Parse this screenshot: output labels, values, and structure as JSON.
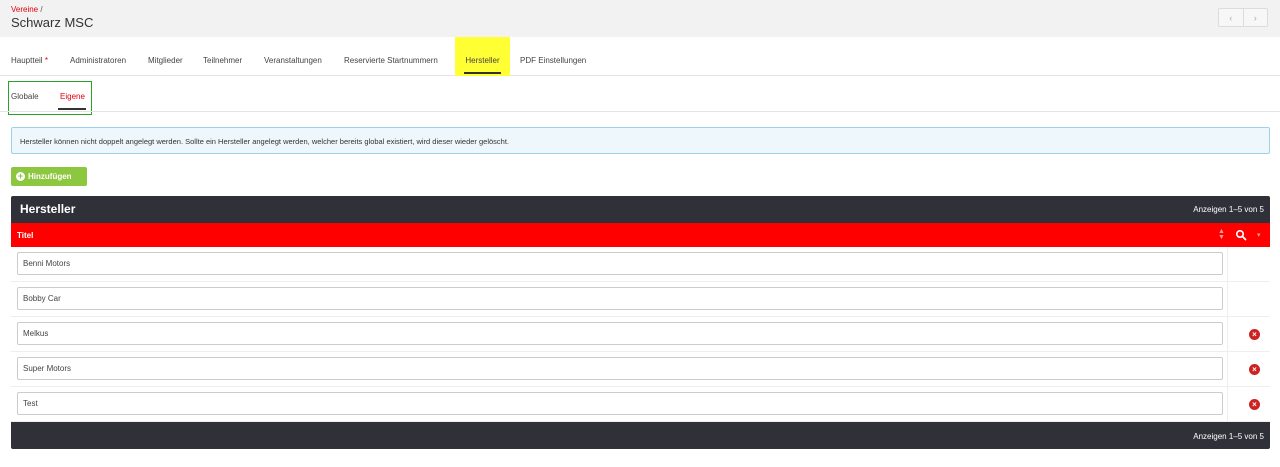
{
  "header": {
    "breadcrumb_root": "Vereine",
    "breadcrumb_sep": "/",
    "title": "Schwarz MSC",
    "prev_icon": "‹",
    "next_icon": "›"
  },
  "main_tabs": [
    {
      "label": "Hauptteil",
      "required_mark": "*"
    },
    {
      "label": "Administratoren"
    },
    {
      "label": "Mitglieder"
    },
    {
      "label": "Teilnehmer"
    },
    {
      "label": "Veranstaltungen"
    },
    {
      "label": "Reservierte Startnummern"
    },
    {
      "label": "Hersteller",
      "active": true
    },
    {
      "label": "PDF Einstellungen"
    }
  ],
  "sub_tabs": [
    {
      "label": "Globale"
    },
    {
      "label": "Eigene",
      "active": true
    }
  ],
  "info_text": "Hersteller können nicht doppelt angelegt werden. Sollte ein Hersteller angelegt werden, welcher bereits global existiert, wird dieser wieder gelöscht.",
  "add_button_label": "Hinzufügen",
  "table": {
    "title": "Hersteller",
    "count_text": "Anzeigen 1–5 von 5",
    "column_title": "Titel",
    "rows": [
      {
        "value": "Benni Motors",
        "deletable": false
      },
      {
        "value": "Bobby Car",
        "deletable": false
      },
      {
        "value": "Melkus",
        "deletable": true
      },
      {
        "value": "Super Motors",
        "deletable": true
      },
      {
        "value": "Test",
        "deletable": true
      }
    ],
    "footer_count_text": "Anzeigen 1–5 von 5"
  },
  "colors": {
    "accent_red": "#e3000f",
    "header_red": "#ff0000",
    "dark_panel": "#303138",
    "add_green": "#8dc63f",
    "highlight_yellow": "#ffff33",
    "annotation_green": "#2ca02c"
  },
  "icons": [
    "chevron-left-icon",
    "chevron-right-icon",
    "plus-circle-icon",
    "sort-icon",
    "search-icon",
    "filter-icon",
    "delete-icon"
  ]
}
